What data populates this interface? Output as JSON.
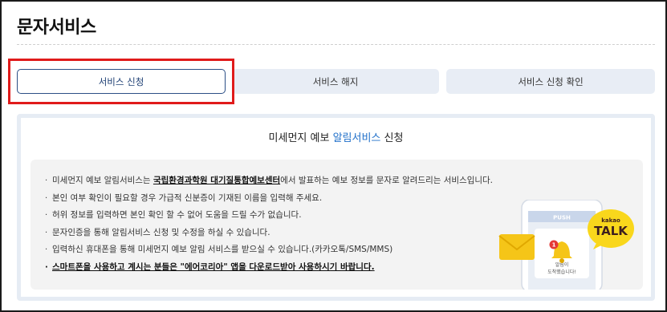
{
  "page": {
    "title": "문자서비스"
  },
  "tabs": [
    {
      "label": "서비스 신청",
      "active": true
    },
    {
      "label": "서비스 해지",
      "active": false
    },
    {
      "label": "서비스 신청 확인",
      "active": false
    }
  ],
  "panel": {
    "heading_prefix": "미세먼지 예보 ",
    "heading_accent": "알림서비스",
    "heading_suffix": " 신청",
    "items": [
      {
        "before": "미세먼지 예보 알림서비스는 ",
        "link": "국립환경과학원 대기질통합예보센터",
        "after": "에서 발표하는 예보 정보를 문자로 알려드리는 서비스입니다."
      },
      {
        "text": "본인 여부 확인이 필요할 경우 가급적 신분증이 기재된 이름을 입력해 주세요."
      },
      {
        "text": "허위 정보를 입력하면 본인 확인 할 수 없어 도움을 드릴 수가 없습니다."
      },
      {
        "text": "문자인증을 통해 알림서비스 신청 및 수정을 하실 수 있습니다."
      },
      {
        "text": "입력하신 휴대폰을 통해 미세먼지 예보 알림 서비스를 받으실 수 있습니다.(카카오톡/SMS/MMS)"
      },
      {
        "text": "스마트폰을 사용하고 계시는 분들은 \"에어코리아\" 앱을 다운로드받아 사용하시기 바랍니다."
      }
    ],
    "bullet": "·"
  },
  "illustration": {
    "phone_header": "PUSH",
    "badge_count": "1",
    "phone_text_line1": "알림이",
    "phone_text_line2": "도착했습니다!",
    "kakao_small": "kakao",
    "kakao_big": "TALK",
    "colors": {
      "kakao_yellow": "#f9d71c",
      "envelope": "#f5c518",
      "phone_body": "#ffffff",
      "phone_screen": "#e9eef5",
      "header_bar": "#c9d6ea",
      "badge": "#e53935"
    }
  }
}
